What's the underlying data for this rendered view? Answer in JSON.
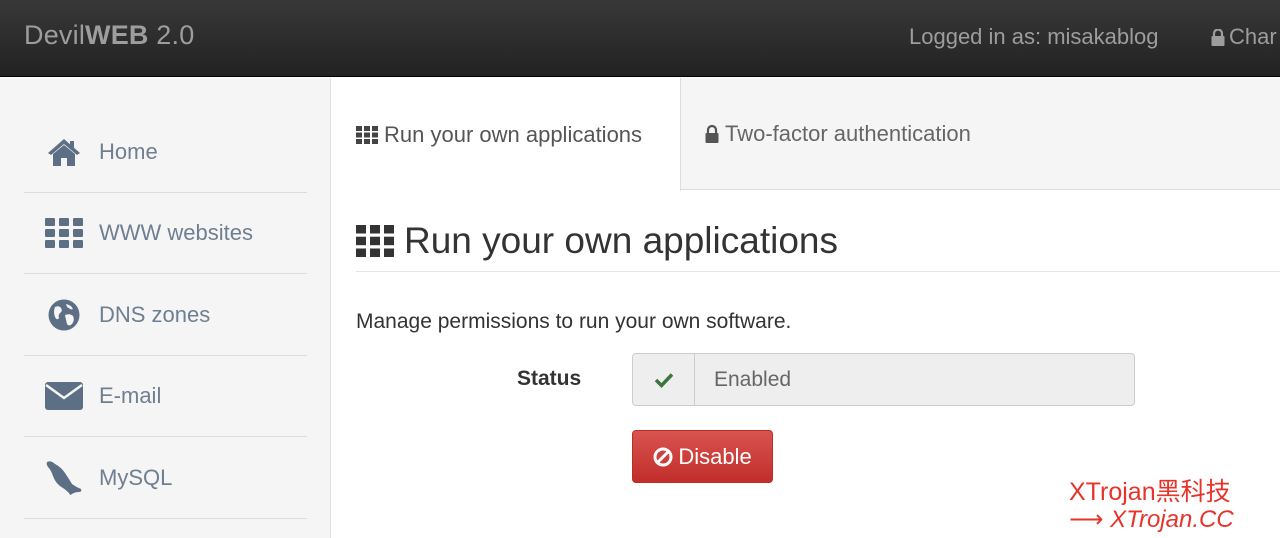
{
  "navbar": {
    "brand_light": "Devil",
    "brand_bold": "WEB",
    "brand_version": " 2.0",
    "logged_in": "Logged in as: misakablog",
    "change_label": "Char"
  },
  "sidebar": {
    "items": [
      {
        "label": "Home",
        "icon": "home-icon"
      },
      {
        "label": "WWW websites",
        "icon": "grid-icon"
      },
      {
        "label": "DNS zones",
        "icon": "globe-icon"
      },
      {
        "label": "E-mail",
        "icon": "envelope-icon"
      },
      {
        "label": "MySQL",
        "icon": "dolphin-icon"
      }
    ]
  },
  "tabs": [
    {
      "label": "Run your own applications",
      "icon": "grid-icon",
      "active": true
    },
    {
      "label": "Two-factor authentication",
      "icon": "lock-icon",
      "active": false
    }
  ],
  "main": {
    "heading": "Run your own applications",
    "description": "Manage permissions to run your own software.",
    "status_label": "Status",
    "status_value": "Enabled",
    "disable_button": "Disable"
  },
  "watermark": {
    "line1": "XTrojan黑科技",
    "line2": "⟶ XTrojan.CC"
  },
  "colors": {
    "navbar": "#2b2b2b",
    "sidebar_text": "#6f7f91",
    "danger": "#d9534f",
    "success_check": "#3c763d",
    "watermark": "#e8332a"
  }
}
